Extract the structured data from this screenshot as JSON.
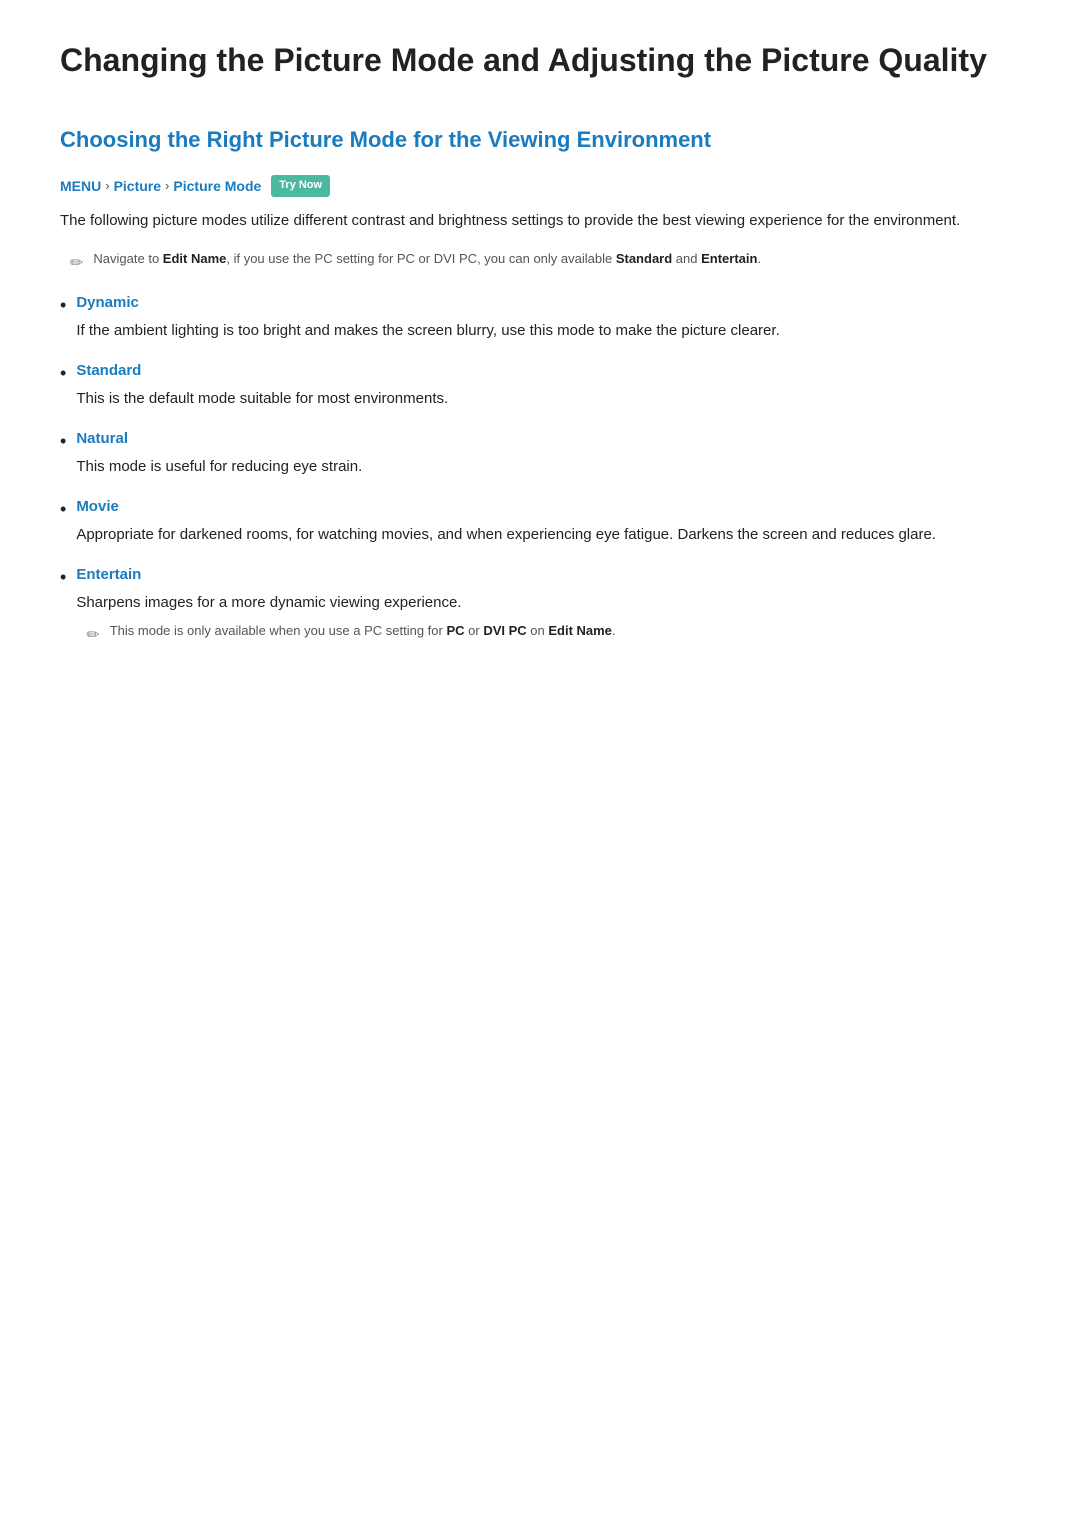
{
  "page": {
    "main_title": "Changing the Picture Mode and Adjusting the Picture Quality",
    "section_title": "Choosing the Right Picture Mode for the Viewing Environment",
    "breadcrumb": {
      "items": [
        "MENU",
        "Picture",
        "Picture Mode"
      ],
      "separators": [
        ">",
        ">"
      ],
      "badge": "Try Now"
    },
    "intro_text": "The following picture modes utilize different contrast and brightness settings to provide the best viewing experience for the environment.",
    "note": {
      "icon": "✏",
      "text_parts": [
        "Navigate to ",
        "Edit Name",
        ", if you use the PC setting for PC or DVI PC, you can only available ",
        "Standard",
        " and ",
        "Entertain",
        "."
      ]
    },
    "modes": [
      {
        "term": "Dynamic",
        "description": "If the ambient lighting is too bright and makes the screen blurry, use this mode to make the picture clearer."
      },
      {
        "term": "Standard",
        "description": "This is the default mode suitable for most environments."
      },
      {
        "term": "Natural",
        "description": "This mode is useful for reducing eye strain."
      },
      {
        "term": "Movie",
        "description": "Appropriate for darkened rooms, for watching movies, and when experiencing eye fatigue. Darkens the screen and reduces glare."
      },
      {
        "term": "Entertain",
        "description": "Sharpens images for a more dynamic viewing experience.",
        "sub_note": {
          "icon": "✏",
          "text_parts": [
            "This mode is only available when you use a PC setting for ",
            "PC",
            " or ",
            "DVI PC",
            " on ",
            "Edit Name",
            "."
          ]
        }
      }
    ],
    "colors": {
      "accent_blue": "#1a7bbf",
      "badge_green": "#4db8a0"
    }
  }
}
